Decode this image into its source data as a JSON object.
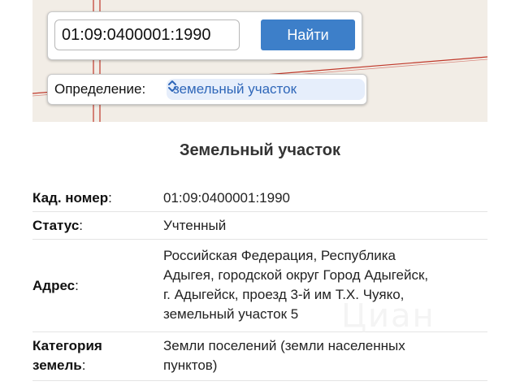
{
  "search": {
    "query": "01:09:0400001:1990",
    "button_label": "Найти"
  },
  "definition": {
    "label": "Определение:",
    "selected": "земельный участок"
  },
  "card": {
    "title": "Земельный участок",
    "rows": [
      {
        "label": "Кад. номер",
        "colon": ":",
        "value": "01:09:0400001:1990"
      },
      {
        "label": "Статус",
        "colon": ":",
        "value": "Учтенный"
      },
      {
        "label": "Адрес",
        "colon": ":",
        "value_lines": [
          "Российская Федерация, Республика",
          "Адыгея, городской округ Город Адыгейск,",
          "г. Адыгейск, проезд 3-й им Т.Х. Чуяко,",
          "земельный участок 5"
        ]
      },
      {
        "label_lines": [
          "Категория",
          "земель"
        ],
        "colon": ":",
        "value_lines": [
          "Земли поселений (земли населенных",
          "пунктов)"
        ]
      }
    ]
  },
  "watermark": "Циан",
  "colors": {
    "accent": "#3d7fc9",
    "select_bg": "#e6eefb",
    "select_text": "#2f67b9",
    "map_bg": "#f2ede6",
    "map_line": "#c0392b"
  }
}
